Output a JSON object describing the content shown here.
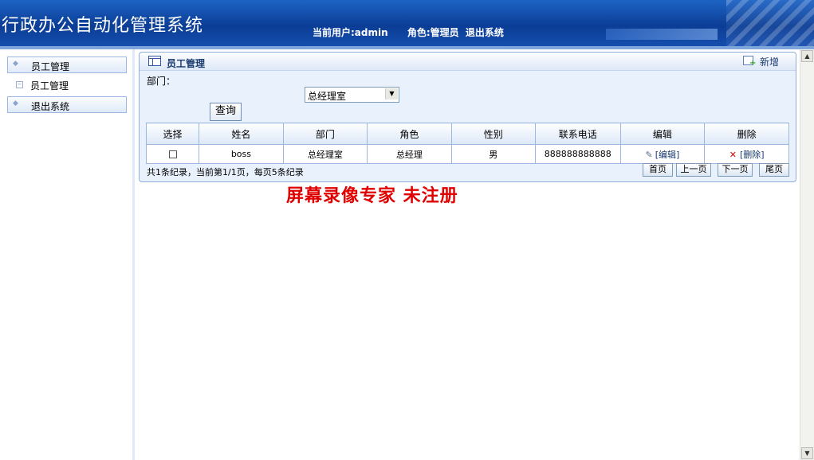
{
  "header": {
    "title": "行政办公自动化管理系统",
    "current_user": "当前用户:admin",
    "role": "角色:管理员",
    "logout": "退出系统"
  },
  "sidebar": {
    "items": [
      {
        "label": "员工管理"
      },
      {
        "label": "员工管理"
      },
      {
        "label": "退出系统"
      }
    ]
  },
  "panel": {
    "title": "员工管理",
    "add_label": "新增",
    "dept_label": "部门：",
    "dept_selected": "总经理室",
    "query_label": "查询"
  },
  "table": {
    "headers": [
      "选择",
      "姓名",
      "部门",
      "角色",
      "性别",
      "联系电话",
      "编辑",
      "删除"
    ],
    "rows": [
      {
        "name": "boss",
        "dept": "总经理室",
        "role": "总经理",
        "gender": "男",
        "phone": "888888888888",
        "edit": "[编辑]",
        "delete": "[删除]"
      }
    ]
  },
  "pager": {
    "info": "共1条纪录，当前第1/1页，每页5条纪录",
    "first": "首页",
    "prev": "上一页",
    "next": "下一页",
    "last": "尾页"
  },
  "watermark": "屏幕录像专家  未注册"
}
